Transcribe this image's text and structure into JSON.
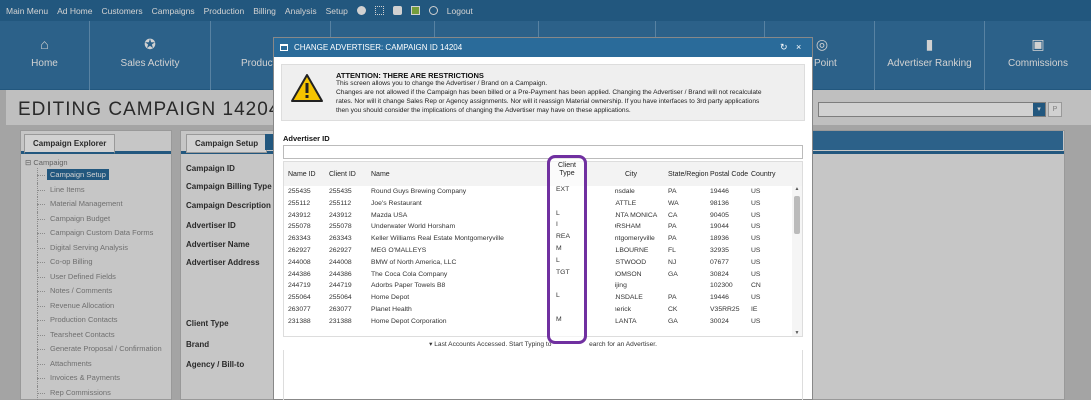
{
  "top_menu": {
    "items_left": [
      "Main Menu",
      "Ad Home",
      "Customers",
      "Campaigns",
      "Production",
      "Billing",
      "Analysis",
      "Setup"
    ],
    "icons": [
      "settings-circle-icon",
      "grid-icon",
      "chat-icon",
      "green-box-icon",
      "info-icon"
    ],
    "logout": "Logout"
  },
  "modules": [
    {
      "label": "Home",
      "icon": "home-icon",
      "glyph": "⌂"
    },
    {
      "label": "Sales Activity",
      "icon": "sales-activity-icon",
      "glyph": "✪"
    },
    {
      "label": "Product/Grou",
      "icon": "product-icon",
      "glyph": "⚙"
    },
    {
      "label": "",
      "icon": "",
      "glyph": ""
    },
    {
      "label": "",
      "icon": "",
      "glyph": ""
    },
    {
      "label": "",
      "icon": "",
      "glyph": ""
    },
    {
      "label": "",
      "icon": "",
      "glyph": ""
    },
    {
      "label": "Point",
      "icon": "point-icon",
      "glyph": "◎"
    },
    {
      "label": "Advertiser Ranking",
      "icon": "ranking-icon",
      "glyph": "▮"
    },
    {
      "label": "Commissions",
      "icon": "commissions-icon",
      "glyph": "▣"
    }
  ],
  "page": {
    "title": "EDITING CAMPAIGN 14204",
    "lookup_button": "P"
  },
  "explorer": {
    "tab": "Campaign Explorer",
    "root": "Campaign",
    "items": [
      "Campaign Setup",
      "Line Items",
      "Material Management",
      "Campaign Budget",
      "Campaign Custom Data Forms",
      "Digital Serving Analysis",
      "Co-op Billing",
      "User Defined Fields",
      "Notes / Comments",
      "Revenue Allocation",
      "Production Contacts",
      "Tearsheet Contacts",
      "Generate Proposal / Confirmation",
      "Attachments",
      "Invoices & Payments",
      "Rep Commissions"
    ],
    "selected": "Campaign Setup"
  },
  "setup": {
    "tab": "Campaign Setup",
    "tab2": "C",
    "fields": [
      {
        "label": "Campaign ID",
        "top": 0
      },
      {
        "label": "Campaign Billing Type",
        "top": 0
      },
      {
        "label": "Campaign Description",
        "top": 0
      },
      {
        "label": "Advertiser ID",
        "top": 0
      },
      {
        "label": "Advertiser Name",
        "top": 0
      },
      {
        "label": "Advertiser Address",
        "top": 0
      },
      {
        "label": "Client Type",
        "top": 0
      },
      {
        "label": "Brand",
        "top": 0
      },
      {
        "label": "Agency / Bill-to",
        "top": 0
      }
    ]
  },
  "modal": {
    "title": "CHANGE ADVERTISER: CAMPAIGN ID 14204",
    "refresh_icon": "↻",
    "close_icon": "×",
    "warning_heading": "ATTENTION: THERE ARE RESTRICTIONS",
    "warning_lines": [
      "This screen allows you to change the Advertiser / Brand on a Campaign.",
      "Changes are not allowed if the Campaign has been billed or a Pre-Payment has been applied. Changing the Advertiser / Brand will not recalculate",
      "rates. Nor will it change Sales Rep or Agency assignments. Nor will it reassign Material ownership. If you have interfaces to 3rd party applications",
      "then you should consider the implications of changing the Advertiser may have on these applications."
    ],
    "advertiser_id_label": "Advertiser ID",
    "advertiser_id_value": "",
    "columns": [
      "Name ID",
      "Client ID",
      "Name",
      "Client Type",
      "City",
      "State/Region",
      "Postal Code",
      "Country"
    ],
    "rows": [
      {
        "name_id": "255435",
        "client_id": "255435",
        "name": "Round Guys Brewing Company",
        "client_type": "EXT",
        "city": "ansdale",
        "state": "PA",
        "postal": "19446",
        "country": "US"
      },
      {
        "name_id": "255112",
        "client_id": "255112",
        "name": "Joe's Restaurant",
        "client_type": "",
        "city": "EATTLE",
        "state": "WA",
        "postal": "98136",
        "country": "US"
      },
      {
        "name_id": "243912",
        "client_id": "243912",
        "name": "Mazda USA",
        "client_type": "L",
        "city": "ANTA MONICA",
        "state": "CA",
        "postal": "90405",
        "country": "US"
      },
      {
        "name_id": "255078",
        "client_id": "255078",
        "name": "Underwater World Horsham",
        "client_type": "I",
        "city": "ORSHAM",
        "state": "PA",
        "postal": "19044",
        "country": "US"
      },
      {
        "name_id": "263343",
        "client_id": "263343",
        "name": "Keller Williams Real Estate Montgomeryville",
        "client_type": "REA",
        "city": "ontgomeryville",
        "state": "PA",
        "postal": "18936",
        "country": "US"
      },
      {
        "name_id": "262927",
        "client_id": "262927",
        "name": "MEG O'MALLEYS",
        "client_type": "M",
        "city": "ELBOURNE",
        "state": "FL",
        "postal": "32935",
        "country": "US"
      },
      {
        "name_id": "244008",
        "client_id": "244008",
        "name": "BMW of North America, LLC",
        "client_type": "L",
        "city": "ESTWOOD",
        "state": "NJ",
        "postal": "07677",
        "country": "US"
      },
      {
        "name_id": "244386",
        "client_id": "244386",
        "name": "The Coca Cola Company",
        "client_type": "TGT",
        "city": "HOMSON",
        "state": "GA",
        "postal": "30824",
        "country": "US"
      },
      {
        "name_id": "244719",
        "client_id": "244719",
        "name": "Adorbs Paper Towels B8",
        "client_type": "",
        "city": "eijing",
        "state": "",
        "postal": "102300",
        "country": "CN"
      },
      {
        "name_id": "255064",
        "client_id": "255064",
        "name": "Home Depot",
        "client_type": "L",
        "city": "ANSDALE",
        "state": "PA",
        "postal": "19446",
        "country": "US"
      },
      {
        "name_id": "263077",
        "client_id": "263077",
        "name": "Planet Health",
        "client_type": "",
        "city": "merick",
        "state": "CK",
        "postal": "V35RR25",
        "country": "IE"
      },
      {
        "name_id": "231388",
        "client_id": "231388",
        "name": "Home Depot Corporation",
        "client_type": "M",
        "city": "TLANTA",
        "state": "GA",
        "postal": "30024",
        "country": "US"
      }
    ],
    "footnote_pre": "▾ Last Accounts Accessed. Start Typing to",
    "footnote_post": "earch for an Advertiser.",
    "highlight_label": "Client Type"
  },
  "colors": {
    "menu": "#2a6b9a",
    "modules": "#3677a8",
    "highlight": "#7030a0",
    "warning": "#f5c400"
  }
}
